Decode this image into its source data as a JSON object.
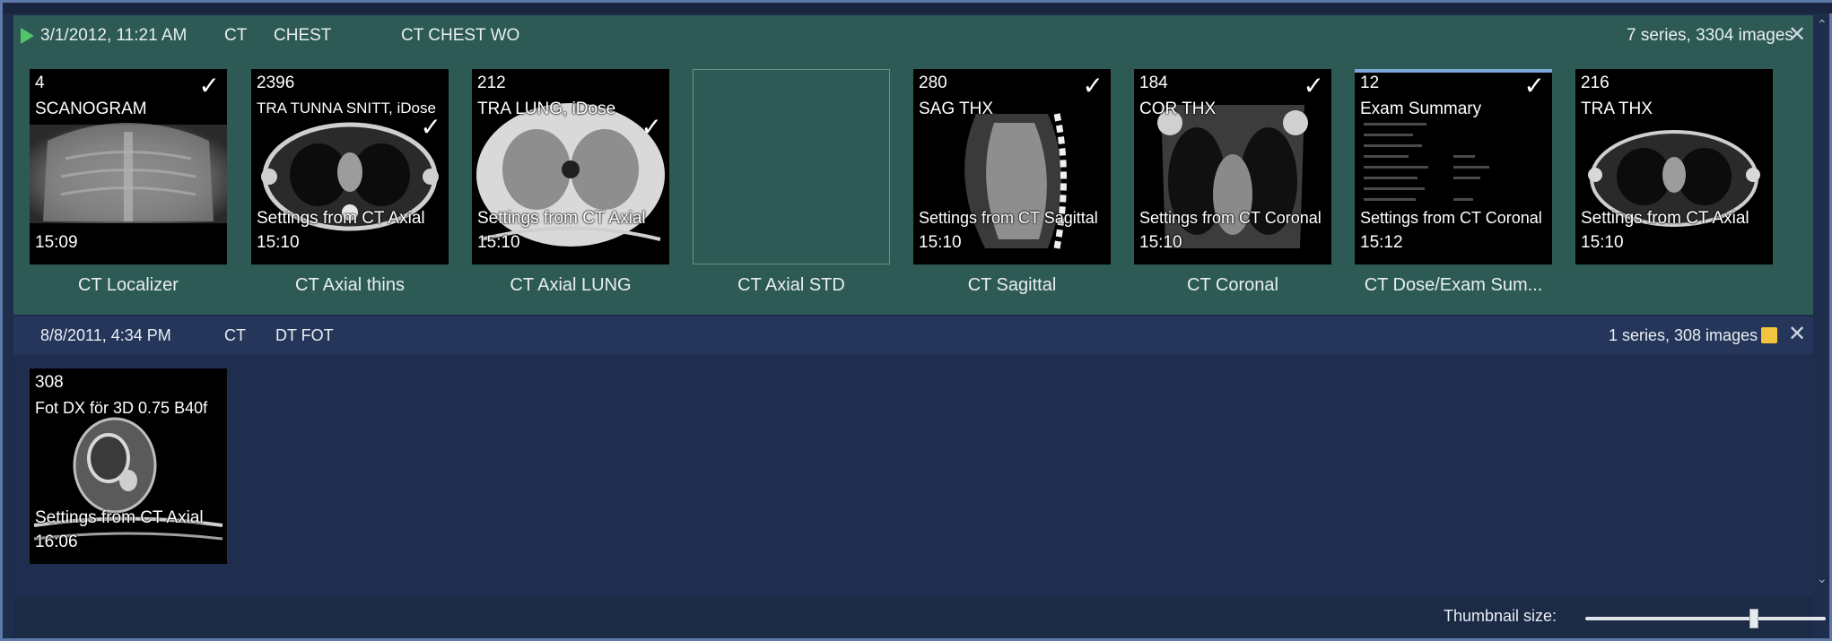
{
  "study1": {
    "date": "3/1/2012, 11:21 AM",
    "modality": "CT",
    "body_part": "CHEST",
    "description": "CT CHEST WO",
    "summary": "7 series, 3304 images",
    "close_label": "✕",
    "series": [
      {
        "count": "4",
        "name": "SCANOGRAM",
        "settings": "",
        "time": "15:09",
        "caption": "CT Localizer",
        "checked": true,
        "check": "✓"
      },
      {
        "count": "2396",
        "name": "TRA TUNNA SNITT, iDose",
        "settings": "Settings from CT Axial",
        "time": "15:10",
        "caption": "CT Axial thins",
        "checked": true,
        "check": "✓"
      },
      {
        "count": "212",
        "name": "TRA LUNG, iDose",
        "settings": "Settings from CT Axial",
        "time": "15:10",
        "caption": "CT Axial LUNG",
        "checked": true,
        "check": "✓"
      },
      {
        "count": "",
        "name": "",
        "settings": "",
        "time": "",
        "caption": "CT Axial STD",
        "checked": false,
        "check": ""
      },
      {
        "count": "280",
        "name": "SAG THX",
        "settings": "Settings from CT Sagittal",
        "time": "15:10",
        "caption": "CT Sagittal",
        "checked": true,
        "check": "✓"
      },
      {
        "count": "184",
        "name": "COR THX",
        "settings": "Settings from CT Coronal",
        "time": "15:10",
        "caption": "CT Coronal",
        "checked": true,
        "check": "✓"
      },
      {
        "count": "12",
        "name": "Exam Summary",
        "settings": "Settings from CT Coronal",
        "time": "15:12",
        "caption": "CT  Dose/Exam Sum...",
        "checked": true,
        "check": "✓"
      },
      {
        "count": "216",
        "name": "TRA THX",
        "settings": "Settings from CT Axial",
        "time": "15:10",
        "caption": "",
        "checked": false,
        "check": ""
      }
    ]
  },
  "study2": {
    "date": "8/8/2011, 4:34 PM",
    "modality": "CT",
    "description": "DT FOT",
    "summary": "1 series, 308 images",
    "close_label": "✕",
    "series": [
      {
        "count": "308",
        "name": "Fot DX för 3D  0.75  B40f",
        "settings": "Settings from CT Axial",
        "time": "16:06",
        "caption": ""
      }
    ]
  },
  "footer": {
    "thumbnail_size_label": "Thumbnail size:",
    "thumbnail_size_value": 0.7
  },
  "scroll": {
    "up": "⌃",
    "down": "⌄"
  }
}
